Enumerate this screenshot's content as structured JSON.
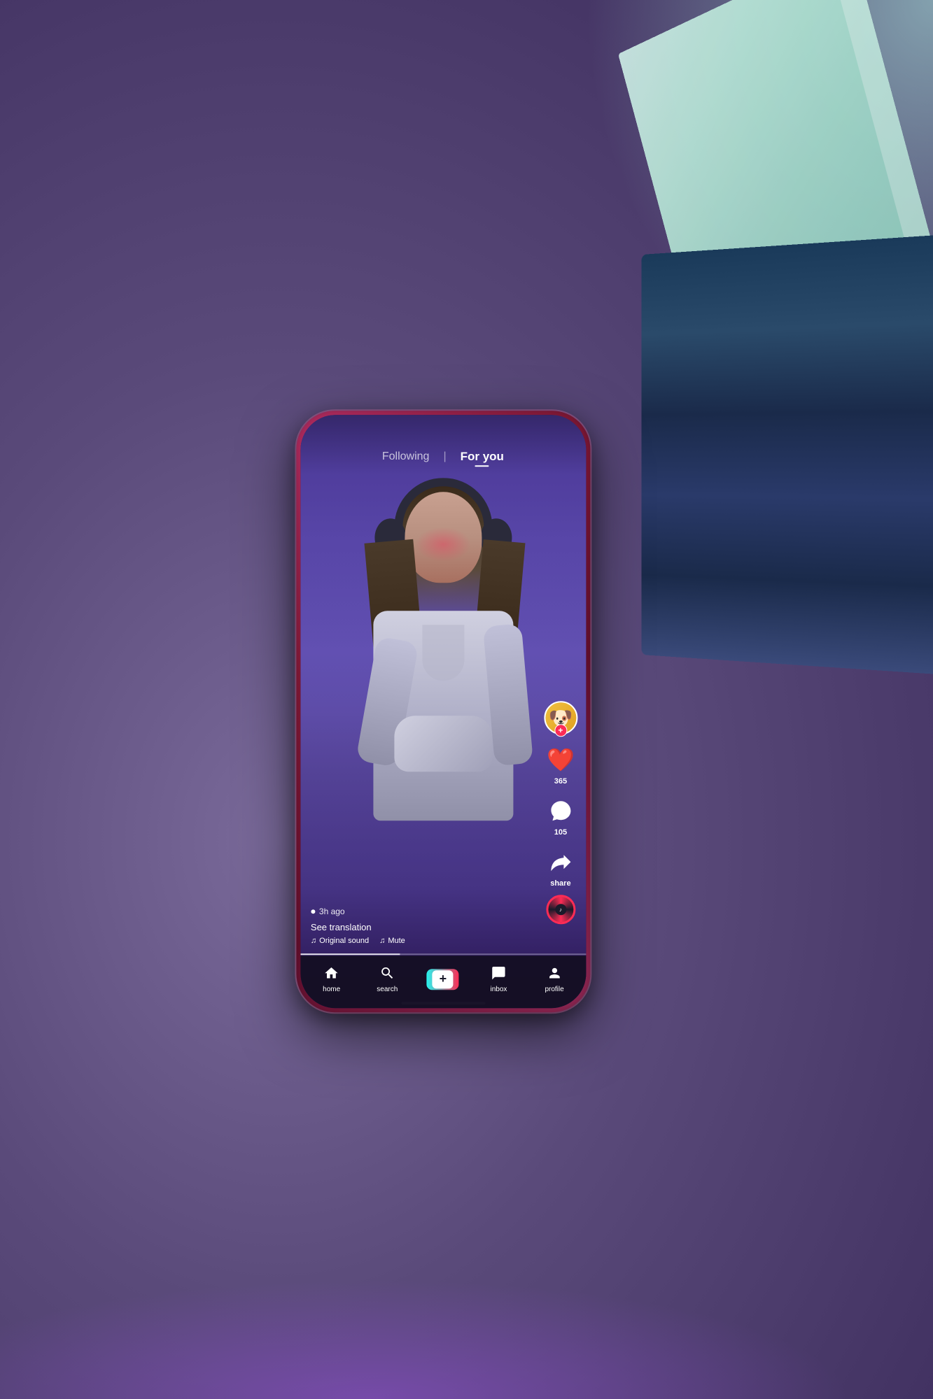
{
  "background": {
    "gradient_start": "#7a6a9a",
    "gradient_end": "#3a2a5a"
  },
  "phone": {
    "border_color": "#c0306a"
  },
  "screen": {
    "top_nav": {
      "following_label": "Following",
      "divider": "|",
      "for_you_label": "For you"
    },
    "video": {
      "time_ago": "3h ago",
      "see_translation": "See translation",
      "original_sound": "Original sound",
      "mute_label": "Mute"
    },
    "actions": {
      "likes_count": "365",
      "comments_count": "105",
      "share_label": "share"
    },
    "bottom_nav": {
      "home_label": "home",
      "search_label": "search",
      "inbox_label": "inbox",
      "profile_label": "profile"
    }
  }
}
